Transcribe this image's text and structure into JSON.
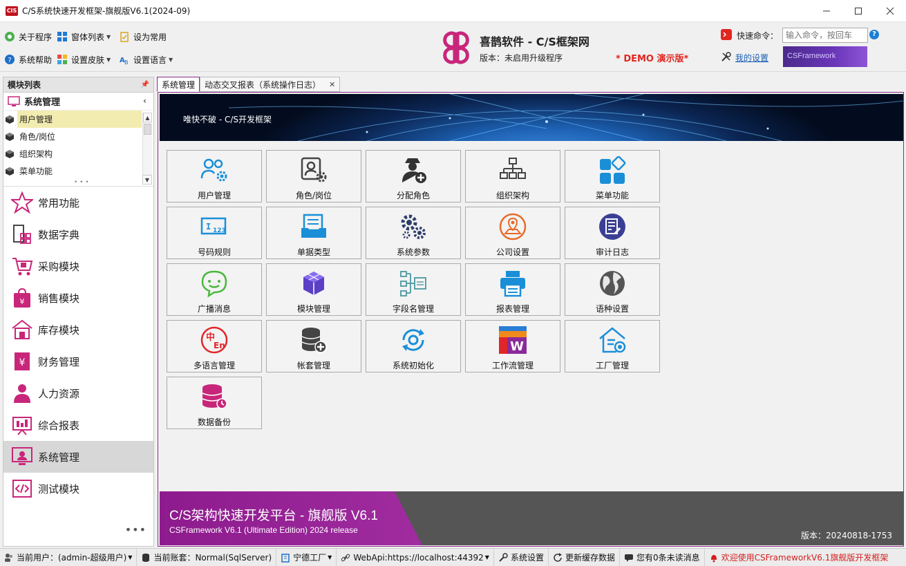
{
  "window": {
    "title": "C/S系统快速开发框架-旗舰版V6.1(2024-09)",
    "app_icon_text": "CIS"
  },
  "toolbar": {
    "about": "关于程序",
    "window_list": "窗体列表",
    "set_common": "设为常用",
    "help": "系统帮助",
    "skin": "设置皮肤",
    "language": "设置语言",
    "brand_title": "喜鹊软件 - C/S框架网",
    "brand_version": "版本：未启用升级程序",
    "demo": "* DEMO 演示版*",
    "quick_cmd_label": "快速命令：",
    "quick_cmd_placeholder": "输入命令，按回车",
    "my_settings": "我的设置",
    "cs_banner": "CSFramework"
  },
  "left_panel": {
    "header": "模块列表",
    "group": "系统管理",
    "items": [
      {
        "label": "用户管理",
        "selected": true
      },
      {
        "label": "角色/岗位",
        "selected": false
      },
      {
        "label": "组织架构",
        "selected": false
      },
      {
        "label": "菜单功能",
        "selected": false
      }
    ],
    "modules": [
      {
        "label": "常用功能",
        "icon": "star-icon",
        "active": false
      },
      {
        "label": "数据字典",
        "icon": "dictionary-icon",
        "active": false
      },
      {
        "label": "采购模块",
        "icon": "cart-icon",
        "active": false
      },
      {
        "label": "销售模块",
        "icon": "shopping-bag-icon",
        "active": false
      },
      {
        "label": "库存模块",
        "icon": "warehouse-icon",
        "active": false
      },
      {
        "label": "财务管理",
        "icon": "finance-icon",
        "active": false
      },
      {
        "label": "人力资源",
        "icon": "person-icon",
        "active": false
      },
      {
        "label": "综合报表",
        "icon": "report-board-icon",
        "active": false
      },
      {
        "label": "系统管理",
        "icon": "system-admin-icon",
        "active": true
      },
      {
        "label": "测试模块",
        "icon": "code-icon",
        "active": false
      }
    ],
    "more": "•••"
  },
  "tabs": [
    {
      "label": "系统管理",
      "active": true
    },
    {
      "label": "动态交叉报表（系统操作日志）",
      "active": false
    }
  ],
  "hero_text": "唯快不破 - C/S开发框架",
  "tiles": [
    {
      "label": "用户管理",
      "icon": "users-gear-icon"
    },
    {
      "label": "角色/岗位",
      "icon": "role-icon"
    },
    {
      "label": "分配角色",
      "icon": "assign-role-icon"
    },
    {
      "label": "组织架构",
      "icon": "org-chart-icon"
    },
    {
      "label": "菜单功能",
      "icon": "menu-tiles-icon"
    },
    {
      "label": "号码规则",
      "icon": "number-rule-icon"
    },
    {
      "label": "单据类型",
      "icon": "document-type-icon"
    },
    {
      "label": "系统参数",
      "icon": "gears-icon"
    },
    {
      "label": "公司设置",
      "icon": "company-location-icon"
    },
    {
      "label": "审计日志",
      "icon": "audit-log-icon"
    },
    {
      "label": "广播消息",
      "icon": "chat-bubble-icon"
    },
    {
      "label": "模块管理",
      "icon": "cube-module-icon"
    },
    {
      "label": "字段名管理",
      "icon": "field-tree-icon"
    },
    {
      "label": "报表管理",
      "icon": "printer-icon"
    },
    {
      "label": "语种设置",
      "icon": "globe-icon"
    },
    {
      "label": "多语言管理",
      "icon": "multi-language-icon"
    },
    {
      "label": "帐套管理",
      "icon": "database-plus-icon"
    },
    {
      "label": "系统初始化",
      "icon": "reset-cycle-icon"
    },
    {
      "label": "工作流管理",
      "icon": "workflow-icon"
    },
    {
      "label": "工厂管理",
      "icon": "factory-house-icon"
    },
    {
      "label": "数据备份",
      "icon": "database-backup-icon"
    }
  ],
  "footer_banner": {
    "title": "C/S架构快速开发平台 - 旗舰版 V6.1",
    "subtitle": "CSFramework V6.1 (Ultimate Edition) 2024 release",
    "version": "版本：20240818-1753"
  },
  "statusbar": {
    "user": "当前用户：(admin-超级用户)",
    "account": "当前账套：Normal(SqlServer)",
    "factory": "宁德工厂",
    "webapi": "WebApi:https://localhost:44392",
    "settings": "系统设置",
    "refresh": "更新缓存数据",
    "messages": "您有0条未读消息",
    "welcome": "欢迎使用CSFrameworkV6.1旗舰版开发框架"
  },
  "colors": {
    "accent_purple": "#8a2a8a",
    "blue_icon": "#1a8fd8",
    "red_demo": "#e0261f",
    "magenta_icon": "#c8267a"
  }
}
